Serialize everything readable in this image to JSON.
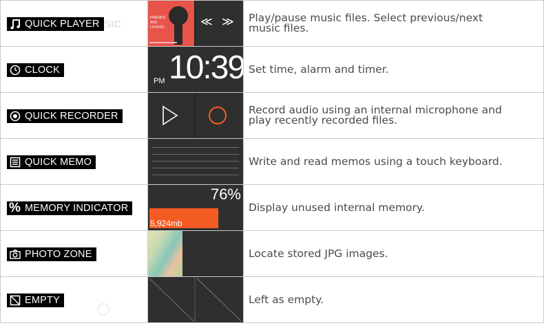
{
  "rows": [
    {
      "label": "QUICK PLAYER",
      "icon": "music-note-icon",
      "album_text": "FRIENDS AND LOVERS",
      "prev_symbol": "≪",
      "next_symbol": "≫",
      "description": "Play/pause music files. Select previous/next music files."
    },
    {
      "label": "CLOCK",
      "icon": "clock-icon",
      "meridiem": "PM",
      "time": "10:39",
      "description": "Set time, alarm and timer."
    },
    {
      "label": "QUICK RECORDER",
      "icon": "record-icon",
      "description": "Record audio using an internal microphone and play recently recorded files."
    },
    {
      "label": "QUICK MEMO",
      "icon": "memo-icon",
      "description": "Write and read memos using a touch keyboard."
    },
    {
      "label": "MEMORY INDICATOR",
      "icon": "percent-icon",
      "percent": "76%",
      "unused": "5,924mb",
      "usage_fraction": 0.76,
      "description": "Display unused internal memory."
    },
    {
      "label": "PHOTO ZONE",
      "icon": "camera-icon",
      "description": "Locate stored JPG images."
    },
    {
      "label": "EMPTY",
      "icon": "empty-box-icon",
      "description": "Left as empty."
    }
  ],
  "colors": {
    "accent": "#f35b22",
    "tile": "#2f2f2f",
    "label_bg": "#000000",
    "text": "#4a4a4a"
  }
}
